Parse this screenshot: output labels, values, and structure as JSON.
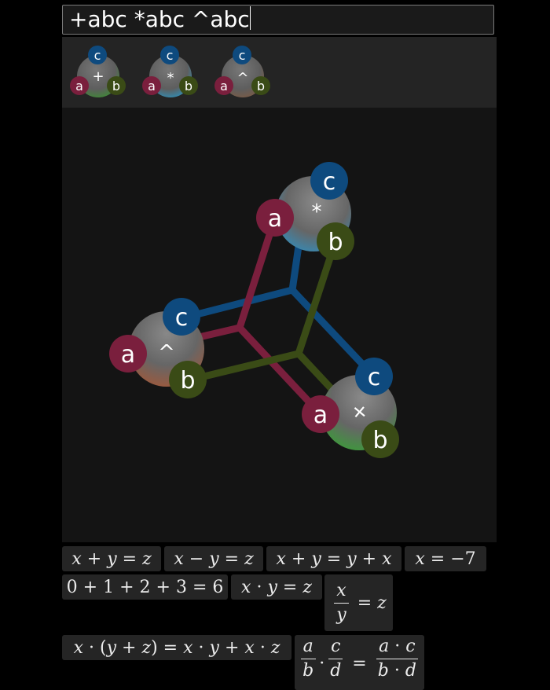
{
  "input": {
    "value": "+abc *abc ^abc"
  },
  "palette": [
    {
      "op": "+",
      "ports": [
        "c",
        "a",
        "b"
      ]
    },
    {
      "op": "*",
      "ports": [
        "c",
        "a",
        "b"
      ]
    },
    {
      "op": "^",
      "ports": [
        "c",
        "a",
        "b"
      ]
    }
  ],
  "graph": {
    "nodes": [
      {
        "op": "*",
        "ports": [
          "c",
          "a",
          "b"
        ]
      },
      {
        "op": "^",
        "ports": [
          "c",
          "a",
          "b"
        ]
      },
      {
        "op": "+",
        "ports": [
          "c",
          "a",
          "b"
        ]
      }
    ]
  },
  "colors": {
    "port_a": "#7a1f3d",
    "port_b": "#3a4b16",
    "port_c": "#0e4a7e",
    "node_body": "#6a6a6a"
  },
  "equations": {
    "e1": [
      "x",
      "+",
      "y",
      "=",
      "z"
    ],
    "e2": [
      "x",
      "−",
      "y",
      "=",
      "z"
    ],
    "e3": [
      "x",
      "+",
      "y",
      "=",
      "y",
      "+",
      "x"
    ],
    "e4": [
      "x",
      "=",
      "−7"
    ],
    "e5": [
      "0",
      "+",
      "1",
      "+",
      "2",
      "+",
      "3",
      "=",
      "6"
    ],
    "e6": [
      "x",
      "·",
      "y",
      "=",
      "z"
    ],
    "e7": {
      "num": "x",
      "den": "y",
      "eq": "=",
      "rhs": "z"
    },
    "e8": [
      "x",
      "·",
      "(",
      "y",
      "+",
      "z",
      ")",
      "=",
      "x",
      "·",
      "y",
      "+",
      "x",
      "·",
      "z"
    ],
    "e9": {
      "f1": {
        "num": "a",
        "den": "b"
      },
      "dot": "·",
      "f2": {
        "num": "c",
        "den": "d"
      },
      "eq": "=",
      "f3": {
        "num": [
          "a",
          "·",
          "c"
        ],
        "den": [
          "b",
          "·",
          "d"
        ]
      }
    }
  }
}
